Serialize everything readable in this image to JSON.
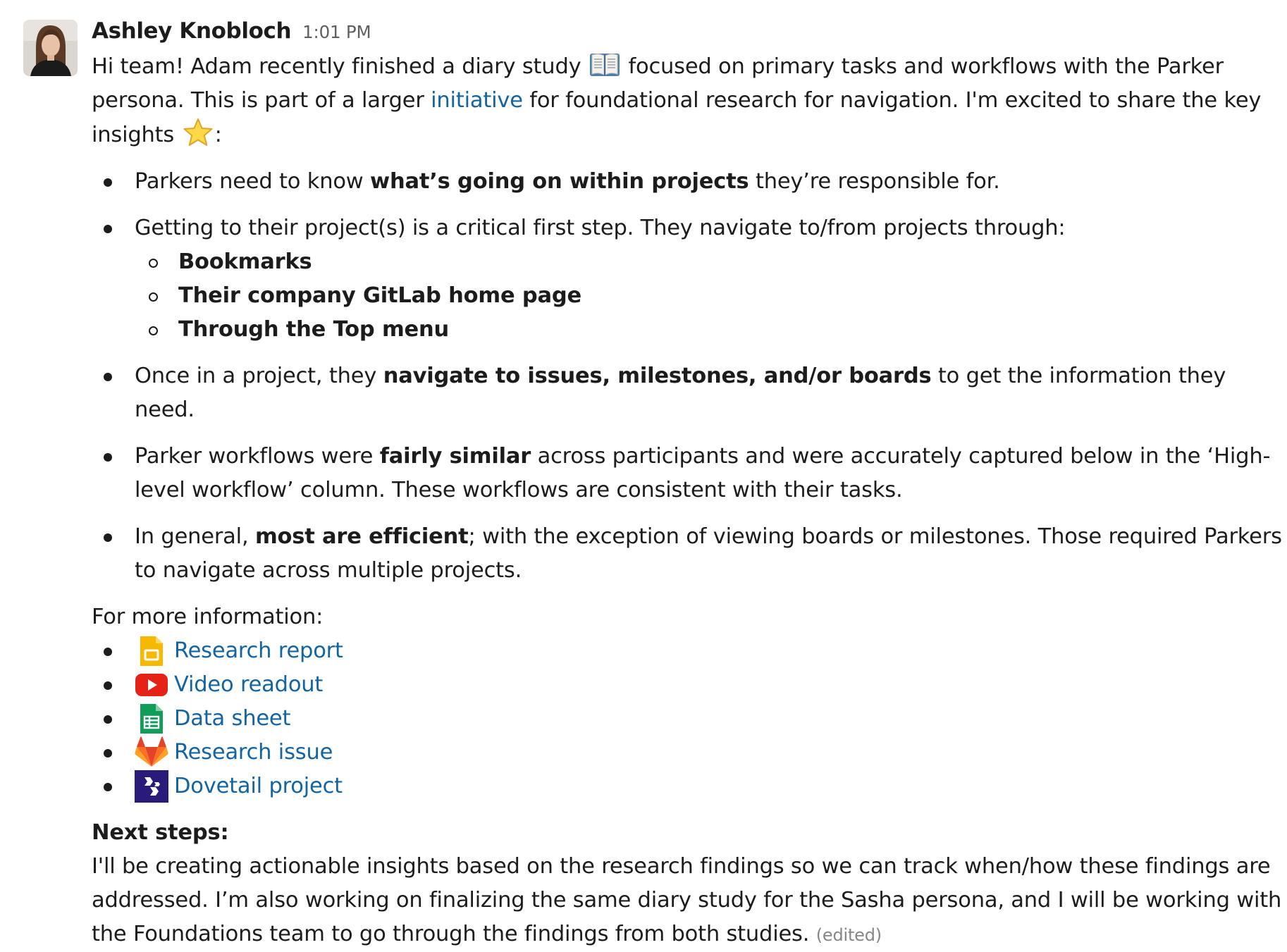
{
  "message": {
    "author": "Ashley Knobloch",
    "timestamp": "1:01 PM",
    "intro": {
      "part1": "Hi team! Adam recently finished a diary study ",
      "emoji_book": "open-book-emoji",
      "part2": " focused on primary tasks and workflows with the Parker persona. This is part of a larger ",
      "link_text": "initiative",
      "part3": " for foundational research for navigation. I'm excited to share the key insights ",
      "emoji_star": "star-emoji",
      "part4": ":"
    },
    "bullets": [
      {
        "before": "Parkers need to know ",
        "bold": "what’s going on within projects",
        "after": " they’re responsible for."
      },
      {
        "text": "Getting to their project(s) is a critical first step. They navigate to/from projects through:",
        "sub_items": [
          "Bookmarks",
          "Their company GitLab home page",
          "Through the Top menu"
        ]
      },
      {
        "before": "Once in a project, they ",
        "bold": "navigate to issues, milestones, and/or boards",
        "after": " to get the information they need."
      },
      {
        "before": "Parker workflows were ",
        "bold": "fairly similar",
        "after": " across participants and were accurately captured below in the ‘High-level workflow’ column. These workflows are consistent with their tasks."
      },
      {
        "before": "In general, ",
        "bold": "most are efficient",
        "after": "; with the exception of viewing boards or milestones. Those required Parkers to navigate across multiple projects."
      }
    ],
    "more_info_label": "For more information:",
    "links": [
      {
        "icon": "google-slides-icon",
        "label": "Research report"
      },
      {
        "icon": "youtube-icon",
        "label": "Video readout"
      },
      {
        "icon": "google-sheets-icon",
        "label": "Data sheet"
      },
      {
        "icon": "gitlab-icon",
        "label": "Research issue"
      },
      {
        "icon": "dovetail-icon",
        "label": "Dovetail project"
      }
    ],
    "next_steps_title": "Next steps:",
    "next_steps_text": "I'll be creating actionable insights based on the research findings so we can track when/how these findings are addressed. I’m also working on finalizing the same diary study for the Sasha persona, and I will be working with the Foundations team to go through the findings from both studies.",
    "edited_label": "(edited)"
  },
  "colors": {
    "text": "#1d1c1d",
    "link": "#1264a3",
    "timestamp": "#616061",
    "edited": "#868686"
  }
}
